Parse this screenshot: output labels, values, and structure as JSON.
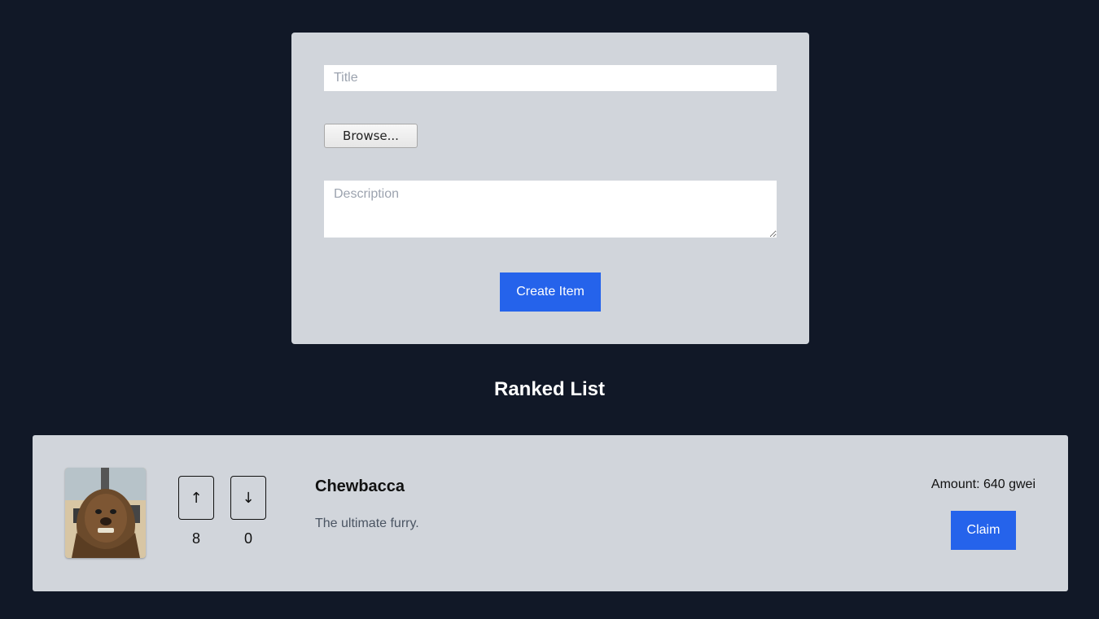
{
  "form": {
    "title_placeholder": "Title",
    "title_value": "",
    "browse_label": "Browse...",
    "description_placeholder": "Description",
    "description_value": "",
    "create_label": "Create Item"
  },
  "ranked_list": {
    "heading": "Ranked List",
    "items": [
      {
        "title": "Chewbacca",
        "description": "The ultimate furry.",
        "upvote_icon": "↑",
        "downvote_icon": "↓",
        "upvotes": "8",
        "downvotes": "0",
        "amount": "Amount: 640 gwei",
        "claim_label": "Claim"
      }
    ]
  },
  "colors": {
    "page_background": "#111827",
    "card_background": "#d1d5db",
    "accent": "#2563eb"
  }
}
